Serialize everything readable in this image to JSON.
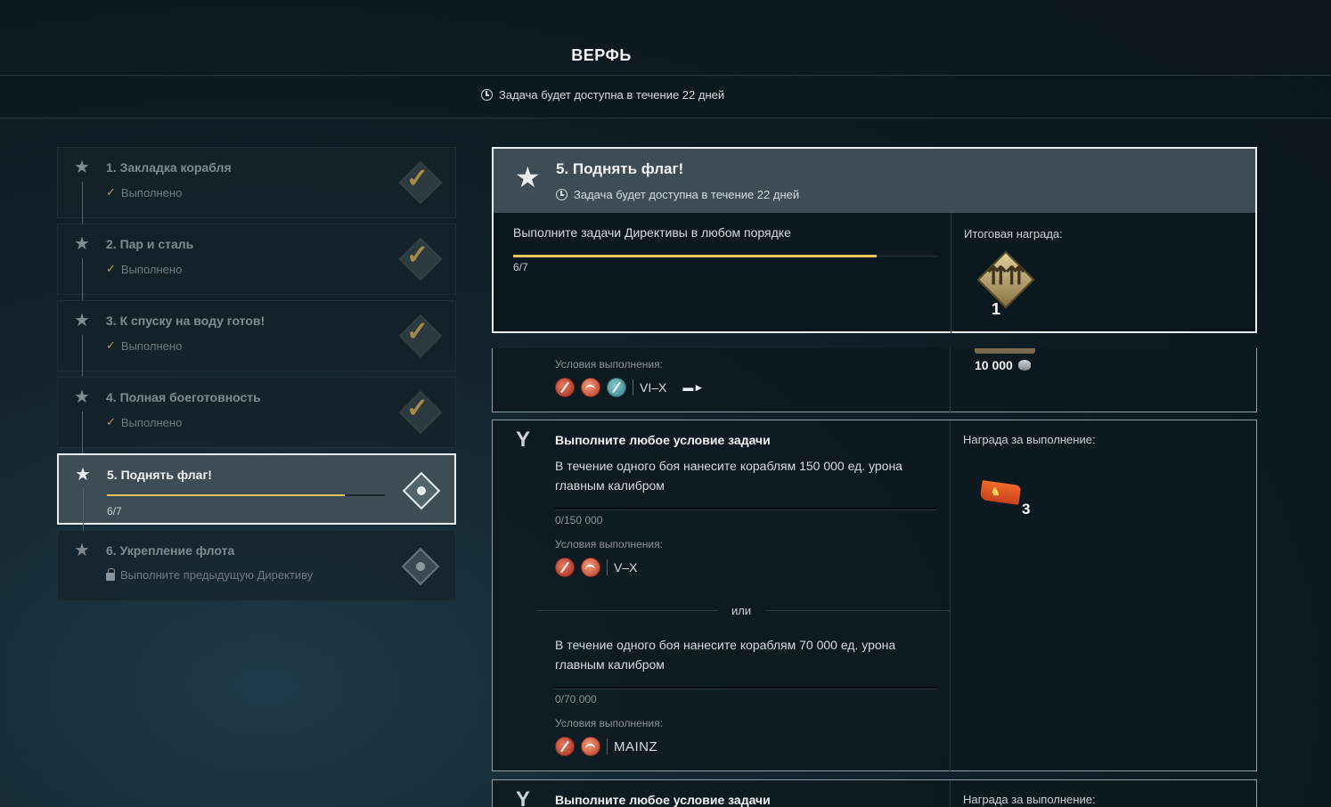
{
  "header": {
    "title": "ВЕРФЬ",
    "availability": "Задача будет доступна в течение 22 дней"
  },
  "steps": [
    {
      "name": "1. Закладка корабля",
      "status": "Выполнено",
      "state": "done"
    },
    {
      "name": "2. Пар и сталь",
      "status": "Выполнено",
      "state": "done"
    },
    {
      "name": "3. К спуску на воду готов!",
      "status": "Выполнено",
      "state": "done"
    },
    {
      "name": "4. Полная боеготовность",
      "status": "Выполнено",
      "state": "done"
    },
    {
      "name": "5. Поднять флаг!",
      "progress": "6/7",
      "progress_fraction": 0.857,
      "state": "active"
    },
    {
      "name": "6. Укрепление флота",
      "status": "Выполните предыдущую Директиву",
      "state": "locked"
    }
  ],
  "directive": {
    "title": "5. Поднять флаг!",
    "availability": "Задача будет доступна в течение 22 дней",
    "task": "Выполните задачи Директивы в любом порядке",
    "progress": "6/7",
    "progress_fraction": 0.857,
    "reward_label": "Итоговая награда:",
    "reward_qty": "1",
    "colors": {
      "accent": "#e8c55a",
      "active_bg": "#3e4d55"
    }
  },
  "partial_task": {
    "conditions_label": "Условия выполнения:",
    "tier": "VI–X",
    "credits": "10 000"
  },
  "task_card": {
    "title": "Выполните любое условие задачи",
    "reward_label": "Награда за выполнение:",
    "reward_qty": "3",
    "conditions": [
      {
        "text": "В течение одного боя нанесите кораблям 150 000 ед. урона главным калибром",
        "counter": "0/150 000",
        "label": "Условия выполнения:",
        "restriction": "V–X"
      },
      {
        "text": "В течение одного боя нанесите кораблям 70 000 ед. урона главным калибром",
        "counter": "0/70 000",
        "label": "Условия выполнения:",
        "restriction": "MAINZ"
      }
    ],
    "or_word": "или"
  },
  "task_card2": {
    "title": "Выполните любое условие задачи",
    "reward_label": "Награда за выполнение:"
  }
}
